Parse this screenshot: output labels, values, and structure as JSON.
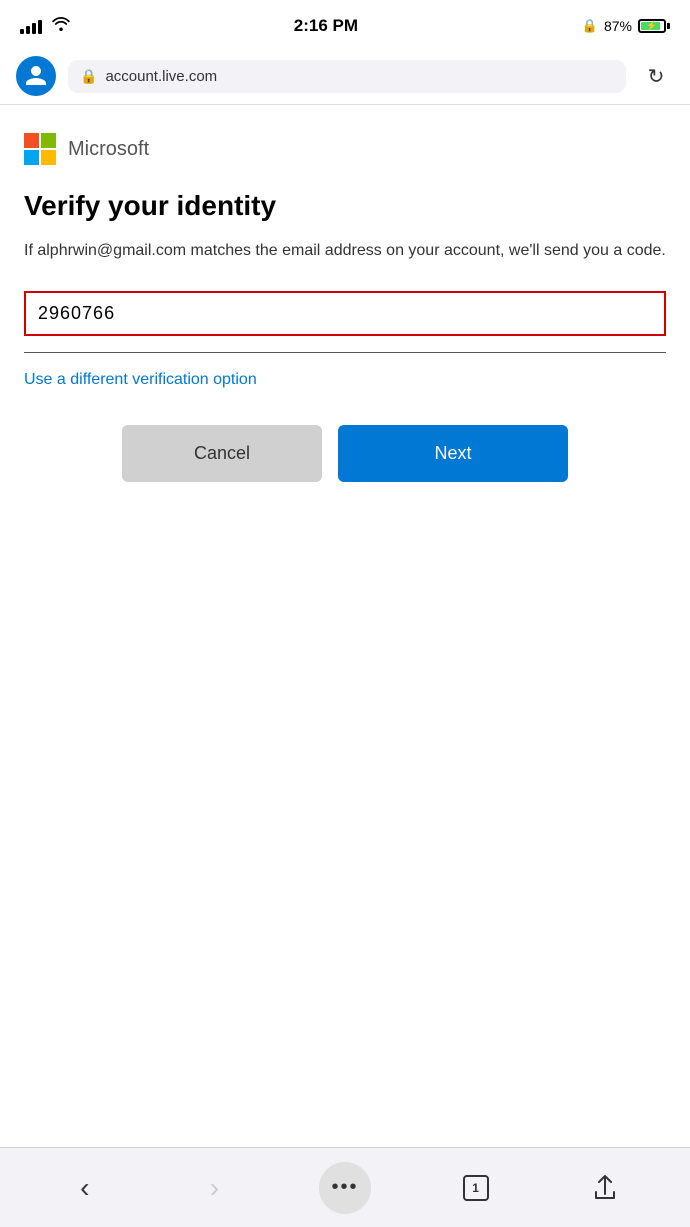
{
  "status_bar": {
    "time": "2:16 PM",
    "battery_percent": "87%",
    "battery_charging": true
  },
  "browser": {
    "url": "account.live.com",
    "refresh_label": "↻"
  },
  "microsoft": {
    "name": "Microsoft"
  },
  "page": {
    "title": "Verify your identity",
    "description": "If alphrwin@gmail.com matches the email address on your account, we'll send you a code.",
    "input_value": "2960766",
    "input_placeholder": "",
    "verify_link": "Use a different verification option",
    "cancel_label": "Cancel",
    "next_label": "Next"
  },
  "bottom_nav": {
    "back_label": "‹",
    "forward_label": "›",
    "dots_label": "•••",
    "tab_count": "1",
    "share_label": "⬆"
  }
}
